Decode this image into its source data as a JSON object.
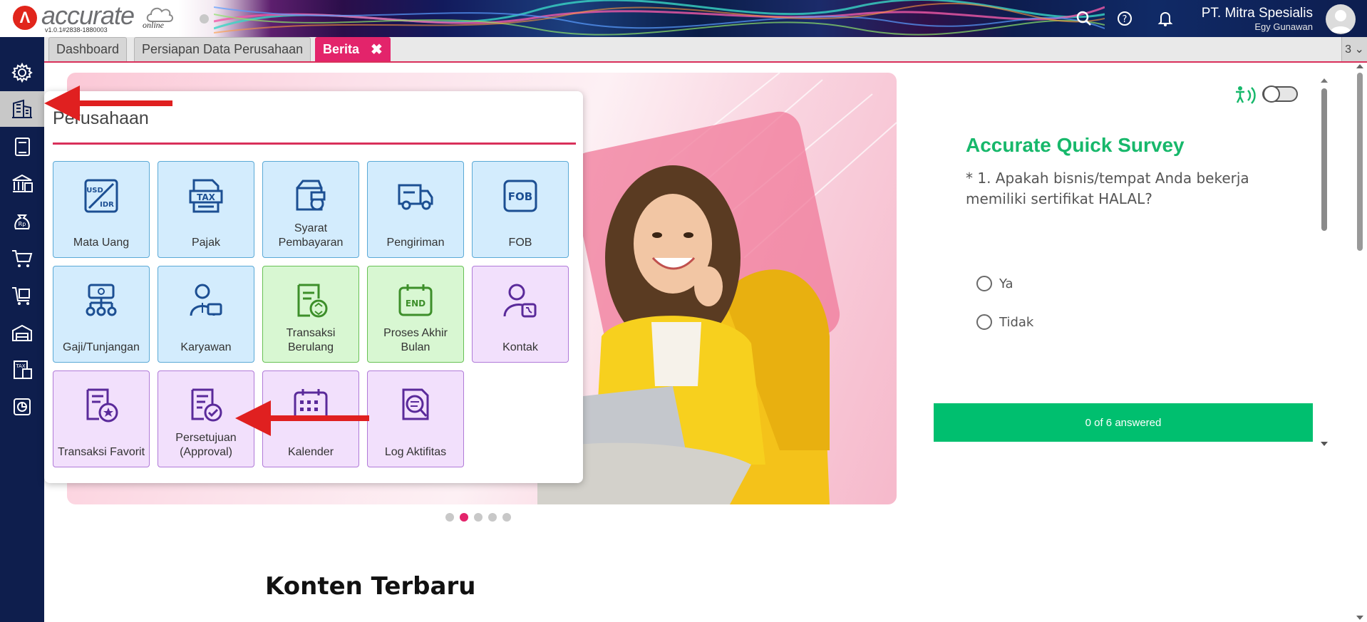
{
  "app": {
    "logo_text": "accurate",
    "logo_suffix": "online",
    "version": "v1.0.1#2838-1880003"
  },
  "header": {
    "company_name": "PT. Mitra Spesialis",
    "user_name": "Egy Gunawan",
    "icons": [
      "search-icon",
      "help-icon",
      "bell-icon",
      "avatar-icon"
    ]
  },
  "sidebar": {
    "items": [
      {
        "icon": "gear-icon"
      },
      {
        "icon": "company-building-icon",
        "active": true
      },
      {
        "icon": "ledger-book-icon"
      },
      {
        "icon": "bank-icon"
      },
      {
        "icon": "money-bag-icon"
      },
      {
        "icon": "cart-icon"
      },
      {
        "icon": "inventory-cart-icon"
      },
      {
        "icon": "warehouse-icon"
      },
      {
        "icon": "tax-report-icon"
      },
      {
        "icon": "dashboard-report-icon"
      }
    ]
  },
  "tabs": [
    {
      "label": "Dashboard"
    },
    {
      "label": "Persiapan Data Perusahaan"
    },
    {
      "label": "Berita",
      "active": true
    }
  ],
  "tab_count": "3 ⌄",
  "panel": {
    "title": "Perusahaan",
    "tiles": [
      {
        "label": "Mata Uang",
        "color": "blue",
        "icon": "currency-usd-idr-icon"
      },
      {
        "label": "Pajak",
        "color": "blue",
        "icon": "tax-document-icon"
      },
      {
        "label": "Syarat\nPembayaran",
        "color": "blue",
        "icon": "wallet-icon"
      },
      {
        "label": "Pengiriman",
        "color": "blue",
        "icon": "delivery-truck-icon"
      },
      {
        "label": "FOB",
        "color": "blue",
        "icon": "fob-icon"
      },
      {
        "label": "Gaji/Tunjangan",
        "color": "blue",
        "icon": "payroll-icon"
      },
      {
        "label": "Karyawan",
        "color": "blue",
        "icon": "employee-icon"
      },
      {
        "label": "Transaksi\nBerulang",
        "color": "green",
        "icon": "recurring-transaction-icon"
      },
      {
        "label": "Proses Akhir\nBulan",
        "color": "green",
        "icon": "end-calendar-icon"
      },
      {
        "label": "Kontak",
        "color": "purple",
        "icon": "contact-icon"
      },
      {
        "label": "Transaksi Favorit",
        "color": "purple",
        "icon": "favorite-receipt-icon"
      },
      {
        "label": "Persetujuan\n(Approval)",
        "color": "purple",
        "icon": "approval-document-icon"
      },
      {
        "label": "Kalender",
        "color": "purple",
        "icon": "calendar-icon"
      },
      {
        "label": "Log Aktifitas",
        "color": "purple",
        "icon": "activity-log-icon"
      }
    ]
  },
  "survey": {
    "title": "Accurate Quick Survey",
    "question": "* 1. Apakah bisnis/tempat Anda bekerja memiliki sertifikat HALAL?",
    "options": [
      "Ya",
      "Tidak"
    ],
    "progress_text": "0 of 6 answered"
  },
  "carousel": {
    "total": 5,
    "active_index": 1
  },
  "section_title": "Konten Terbaru",
  "colors": {
    "accent": "#e3246b",
    "sidebar_bg": "#0e1e4d",
    "survey_green": "#00bf6f",
    "tile_blue": "#d3ecfd",
    "tile_green": "#d8f7d2",
    "tile_purple": "#f2e0fc",
    "annotation_arrow": "#e02020"
  }
}
